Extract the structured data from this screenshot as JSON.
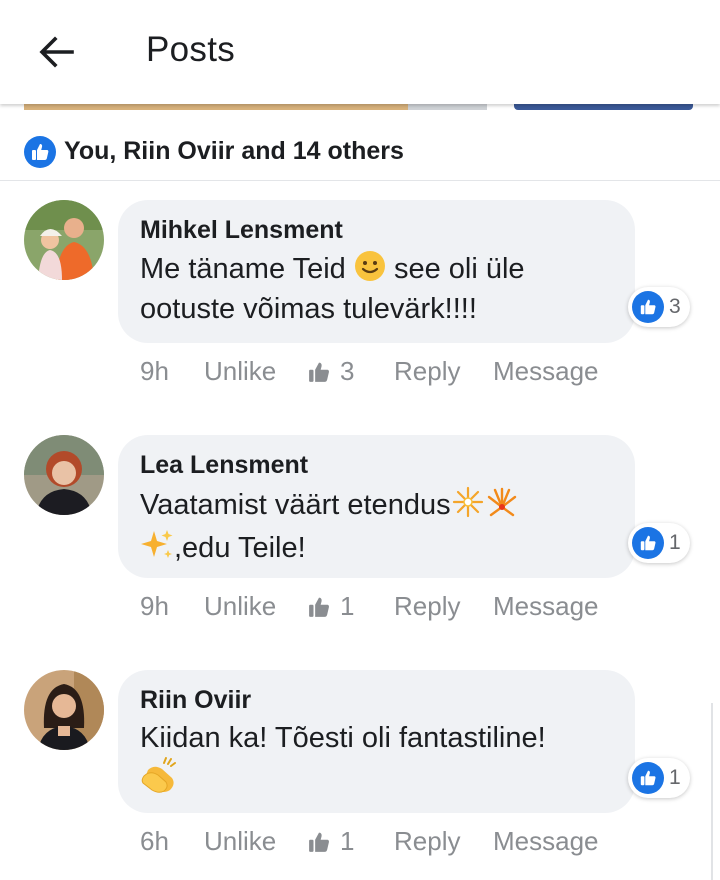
{
  "header": {
    "title": "Posts",
    "back_icon": "arrow-left-icon"
  },
  "reactions": {
    "summary": "You, Riin Oviir and 14 others",
    "icon": "thumbs-up-icon",
    "accent": "#1b74e4"
  },
  "comments": [
    {
      "author": "Mihkel Lensment",
      "line1": "Me täname Teid",
      "line1_after": "see oli üle",
      "line2": "ootuste võimas tulevärk!!!!",
      "emoji": "slightly-smiling-face",
      "likes": "3",
      "actions": {
        "time": "9h",
        "unlike": "Unlike",
        "like_count": "3",
        "reply": "Reply",
        "message": "Message"
      }
    },
    {
      "author": "Lea Lensment",
      "line1": "Vaatamist väärt etendus",
      "line2": ",edu Teile!",
      "emoji": [
        "sparkler-fireworks",
        "fireworks",
        "sparkles"
      ],
      "likes": "1",
      "actions": {
        "time": "9h",
        "unlike": "Unlike",
        "like_count": "1",
        "reply": "Reply",
        "message": "Message"
      }
    },
    {
      "author": "Riin Oviir",
      "line1": "Kiidan ka! Tõesti oli fantastiline!",
      "emoji": "clapping-hands",
      "likes": "1",
      "actions": {
        "time": "6h",
        "unlike": "Unlike",
        "like_count": "1",
        "reply": "Reply",
        "message": "Message"
      }
    }
  ]
}
